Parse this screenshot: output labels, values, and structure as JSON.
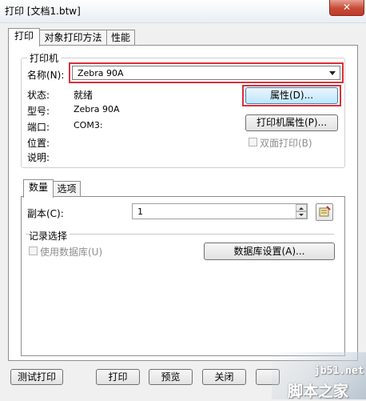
{
  "window": {
    "title": "打印 [文档1.btw]",
    "close_glyph": "✕"
  },
  "tabs": [
    "打印",
    "对象打印方法",
    "性能"
  ],
  "printer_group": {
    "title": "打印机",
    "name_label": "名称(N):",
    "name_value": "Zebra 90A",
    "status_label": "状态:",
    "status_value": "就绪",
    "model_label": "型号:",
    "model_value": "Zebra 90A",
    "port_label": "端口:",
    "port_value": "COM3:",
    "location_label": "位置:",
    "comment_label": "说明:",
    "properties_button": "属性(D)...",
    "printer_properties_button": "打印机属性(P)...",
    "duplex_label": "双面打印(B)"
  },
  "inner_tabs": [
    "数量",
    "选项"
  ],
  "quantity": {
    "copies_label": "副本(C):",
    "copies_value": "1",
    "record_group_title": "记录选择",
    "use_database_label": "使用数据库(U)",
    "database_settings_button": "数据库设置(A)..."
  },
  "footer": {
    "test_print": "测试打印",
    "print": "打印",
    "preview": "预览",
    "close": "关闭"
  },
  "watermark": {
    "site": "jb51.net",
    "brand": "脚本之家"
  },
  "colors": {
    "highlight_border": "#d8303a",
    "focus_button": "#bee6fd",
    "close_button": "#c74a36"
  }
}
